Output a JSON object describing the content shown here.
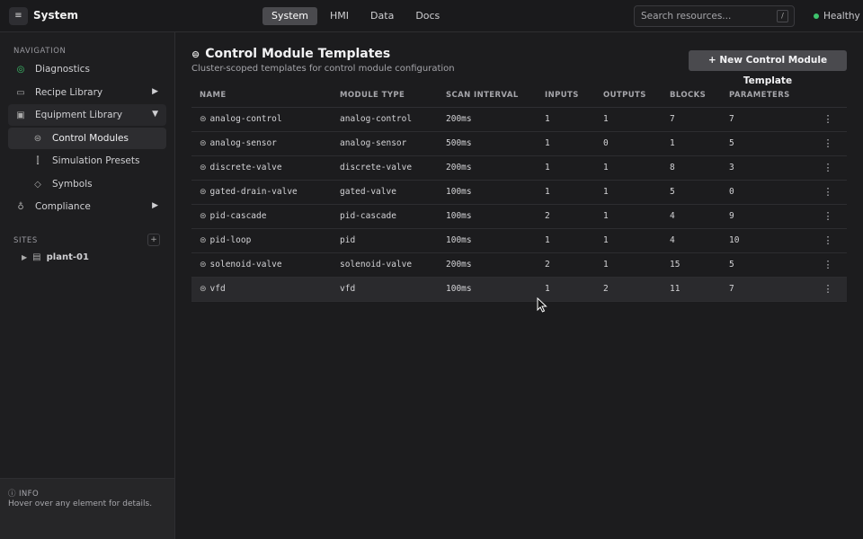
{
  "topbar": {
    "menu_icon": "≡",
    "title": "System",
    "tabs": [
      {
        "label": "System",
        "active": true
      },
      {
        "label": "HMI",
        "active": false
      },
      {
        "label": "Data",
        "active": false
      },
      {
        "label": "Docs",
        "active": false
      }
    ],
    "search_placeholder": "Search resources...",
    "search_shortcut": "/",
    "status": "Healthy",
    "status_color": "#3ec46d"
  },
  "sidebar": {
    "nav_label": "NAVIGATION",
    "items": [
      {
        "label": "Diagnostics",
        "icon": "diagnostics-icon"
      },
      {
        "label": "Recipe Library",
        "icon": "book-icon",
        "arrow": "▶"
      },
      {
        "label": "Equipment Library",
        "icon": "library-icon",
        "arrow": "▼"
      },
      {
        "label": "Control Modules",
        "icon": "module-icon"
      },
      {
        "label": "Simulation Presets",
        "icon": "sliders-icon"
      },
      {
        "label": "Symbols",
        "icon": "diamond-icon"
      },
      {
        "label": "Compliance",
        "icon": "badge-icon",
        "arrow": "▶"
      }
    ],
    "sites_label": "SITES",
    "sites_add": "+",
    "site": {
      "label": "plant-01",
      "arrow": "▶"
    },
    "info_title": "ⓘ INFO",
    "info_text": "Hover over any element for details."
  },
  "main": {
    "title": "Control Module Templates",
    "subtitle": "Cluster-scoped templates for control module configuration",
    "new_button": "+ New Control Module Template",
    "columns": [
      "NAME",
      "MODULE TYPE",
      "SCAN INTERVAL",
      "INPUTS",
      "OUTPUTS",
      "BLOCKS",
      "PARAMETERS"
    ],
    "rows": [
      {
        "name": "analog-control",
        "type": "analog-control",
        "scan": "200ms",
        "inputs": "1",
        "outputs": "1",
        "blocks": "7",
        "params": "7"
      },
      {
        "name": "analog-sensor",
        "type": "analog-sensor",
        "scan": "500ms",
        "inputs": "1",
        "outputs": "0",
        "blocks": "1",
        "params": "5"
      },
      {
        "name": "discrete-valve",
        "type": "discrete-valve",
        "scan": "200ms",
        "inputs": "1",
        "outputs": "1",
        "blocks": "8",
        "params": "3"
      },
      {
        "name": "gated-drain-valve",
        "type": "gated-valve",
        "scan": "100ms",
        "inputs": "1",
        "outputs": "1",
        "blocks": "5",
        "params": "0"
      },
      {
        "name": "pid-cascade",
        "type": "pid-cascade",
        "scan": "100ms",
        "inputs": "2",
        "outputs": "1",
        "blocks": "4",
        "params": "9"
      },
      {
        "name": "pid-loop",
        "type": "pid",
        "scan": "100ms",
        "inputs": "1",
        "outputs": "1",
        "blocks": "4",
        "params": "10"
      },
      {
        "name": "solenoid-valve",
        "type": "solenoid-valve",
        "scan": "200ms",
        "inputs": "2",
        "outputs": "1",
        "blocks": "15",
        "params": "5"
      },
      {
        "name": "vfd",
        "type": "vfd",
        "scan": "100ms",
        "inputs": "1",
        "outputs": "2",
        "blocks": "11",
        "params": "7"
      }
    ]
  }
}
